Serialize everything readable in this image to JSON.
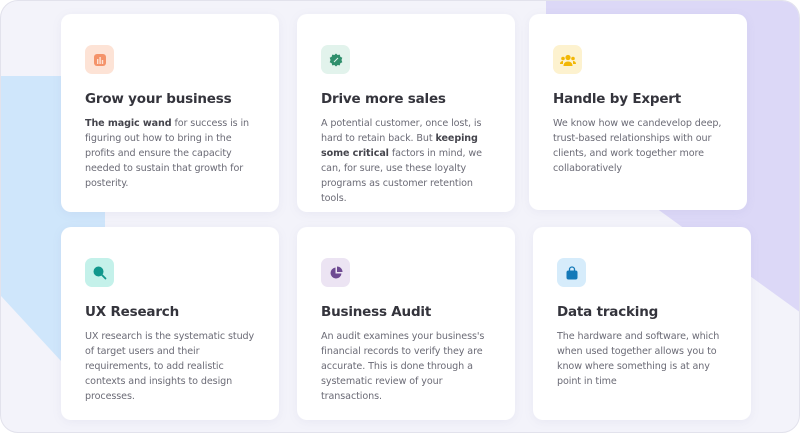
{
  "cards": [
    {
      "title": "Grow your business",
      "body_bold": "The magic wand",
      "body": " for success is in figuring out how to bring in the profits and ensure the capacity needed to sustain that growth for posterity.",
      "icon": "bar-chart-icon",
      "icon_bg": "#fde3d6",
      "icon_color": "#f4936a"
    },
    {
      "title": "Drive more sales",
      "body_pre": "A potential customer, once lost, is hard to retain back. But ",
      "body_bold": "keeping some critical",
      "body": " factors in mind, we can, for sure, use these loyalty programs as customer retention tools.",
      "icon": "discount-badge-icon",
      "icon_bg": "#e2f3ec",
      "icon_color": "#2f8f6c"
    },
    {
      "title": "Handle by Expert",
      "body": "We know how we candevelop deep, trust-based relationships with our clients, and work together more collaboratively",
      "icon": "team-icon",
      "icon_bg": "#fdf2cf",
      "icon_color": "#f2b705"
    },
    {
      "title": "UX Research",
      "body": "UX research is the systematic study of target users and their requirements, to add realistic contexts and insights to design processes.",
      "icon": "search-icon",
      "icon_bg": "#c4f1ea",
      "icon_color": "#11978c"
    },
    {
      "title": "Business Audit",
      "body": "An audit examines your business's financial records to verify they are accurate. This is done through a systematic review of your transactions.",
      "icon": "pie-chart-icon",
      "icon_bg": "#ece4f3",
      "icon_color": "#6e4a92"
    },
    {
      "title": "Data tracking",
      "body": "The hardware and software, which when used together allows you to know where something is at any point in time",
      "icon": "shopping-bag-icon",
      "icon_bg": "#d6ecfb",
      "icon_color": "#1479b8"
    }
  ]
}
